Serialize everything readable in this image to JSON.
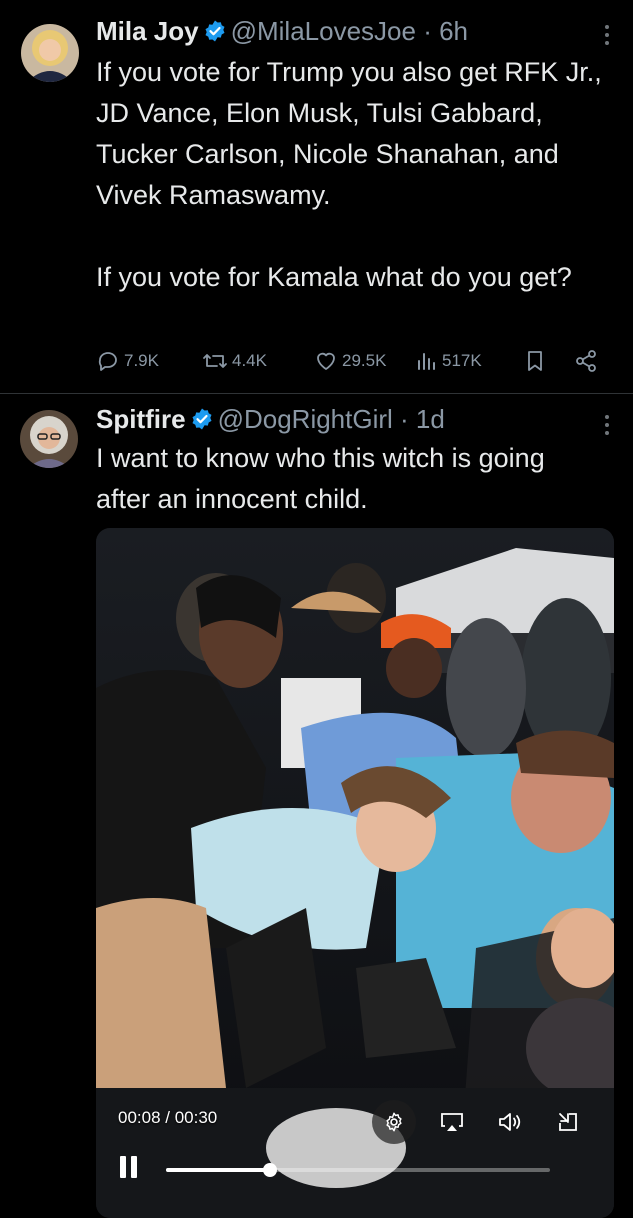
{
  "tweets": [
    {
      "name": "Mila Joy",
      "handle": "@MilaLovesJoe",
      "time": "6h",
      "text": "If you vote for Trump you also get RFK Jr., JD Vance, Elon Musk, Tulsi Gabbard, Tucker Carlson, Nicole Shanahan, and Vivek Ramaswamy.\n\nIf you vote for Kamala what do you get?",
      "replies": "7.9K",
      "reposts": "4.4K",
      "likes": "29.5K",
      "views": "517K"
    },
    {
      "name": "Spitfire",
      "handle": "@DogRightGirl",
      "time": "1d",
      "text": "I want to know who this witch is going after an innocent child.",
      "video": {
        "timecode": "00:08 / 00:30",
        "progress": 0.27
      }
    }
  ],
  "icons": {
    "verified": "verified-badge-icon",
    "more": "more-icon",
    "reply": "reply-icon",
    "repost": "repost-icon",
    "like": "like-icon",
    "views": "views-icon",
    "bookmark": "bookmark-icon",
    "share": "share-icon",
    "settings": "settings-icon",
    "airplay": "airplay-icon",
    "volume": "volume-icon",
    "exit_fullscreen": "exit-fullscreen-icon",
    "pause": "pause-icon"
  },
  "colors": {
    "background": "#000000",
    "text": "#e7e9ea",
    "secondary": "#8b98a5",
    "verified": "#1d9bf0"
  }
}
